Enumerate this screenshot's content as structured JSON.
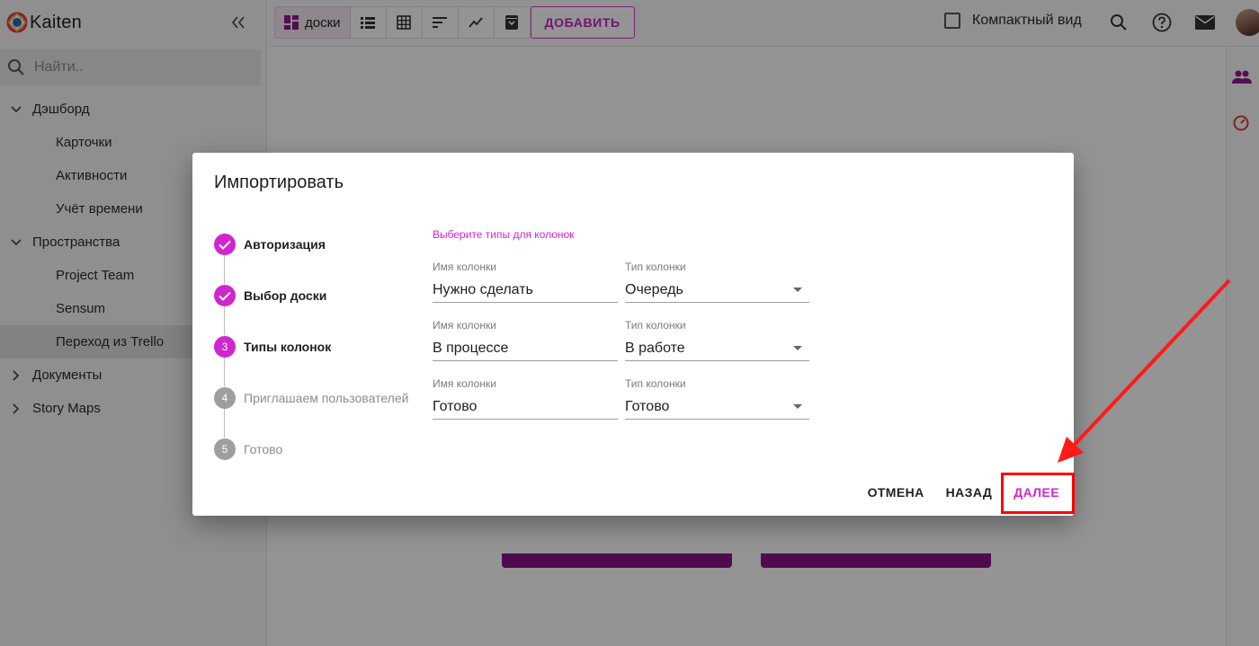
{
  "app": {
    "name": "Kaiten"
  },
  "sidebar": {
    "search_placeholder": "Найти..",
    "groups": [
      {
        "label": "Дэшборд",
        "items": [
          "Карточки",
          "Активности",
          "Учёт времени"
        ]
      },
      {
        "label": "Пространства",
        "items": [
          "Project Team",
          "Sensum",
          "Переход из Trello"
        ]
      },
      {
        "label": "Документы",
        "items": []
      },
      {
        "label": "Story Maps",
        "items": []
      }
    ]
  },
  "toolbar": {
    "boards_label": "доски",
    "add_label": "ДОБАВИТЬ",
    "compact_label": "Компактный вид",
    "icons": [
      "list-view-icon",
      "grid-view-icon",
      "sort-icon",
      "chart-icon",
      "archive-icon"
    ]
  },
  "dialog": {
    "title": "Импортировать",
    "steps": [
      {
        "number": "1",
        "label": "Авторизация",
        "state": "done"
      },
      {
        "number": "2",
        "label": "Выбор доски",
        "state": "done"
      },
      {
        "number": "3",
        "label": "Типы колонок",
        "state": "current"
      },
      {
        "number": "4",
        "label": "Приглашаем пользователей",
        "state": "todo"
      },
      {
        "number": "5",
        "label": "Готово",
        "state": "todo"
      }
    ],
    "section_title": "Выберите типы для колонок",
    "name_label": "Имя колонки",
    "type_label": "Тип колонки",
    "rows": [
      {
        "name": "Нужно сделать",
        "type": "Очередь"
      },
      {
        "name": "В процессе",
        "type": "В работе"
      },
      {
        "name": "Готово",
        "type": "Готово"
      }
    ],
    "cancel_label": "ОТМЕНА",
    "back_label": "НАЗАД",
    "next_label": "ДАЛЕЕ"
  },
  "colors": {
    "accent": "#d026cf",
    "annotation": "#ff0000"
  }
}
